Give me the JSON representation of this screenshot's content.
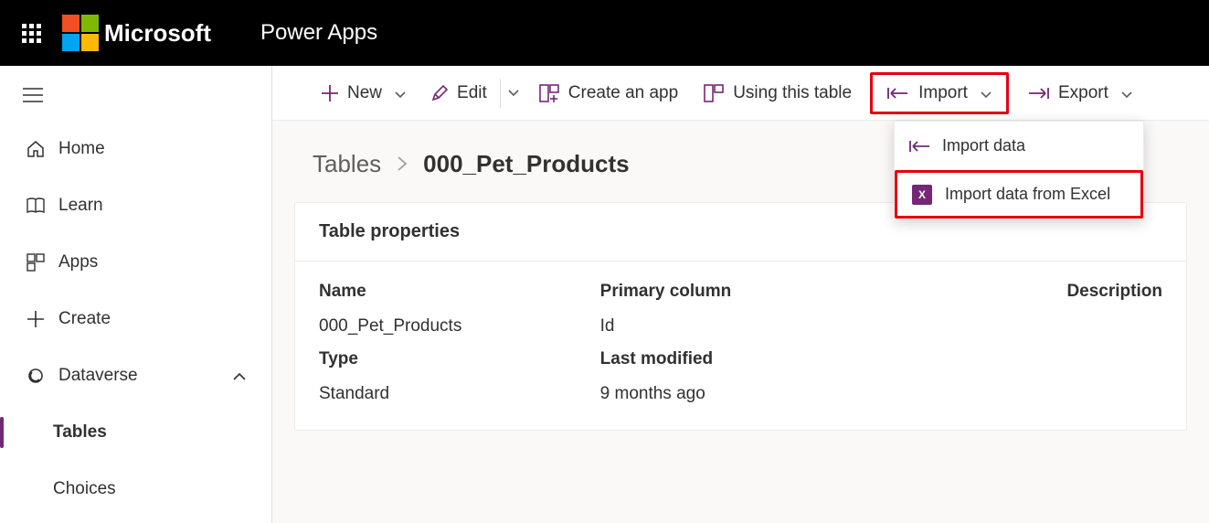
{
  "header": {
    "brand": "Microsoft",
    "app": "Power Apps"
  },
  "sidebar": {
    "items": [
      {
        "label": "Home"
      },
      {
        "label": "Learn"
      },
      {
        "label": "Apps"
      },
      {
        "label": "Create"
      },
      {
        "label": "Dataverse"
      },
      {
        "label": "Tables"
      },
      {
        "label": "Choices"
      }
    ]
  },
  "commands": {
    "new": "New",
    "edit": "Edit",
    "create_app": "Create an app",
    "using_table": "Using this table",
    "import": "Import",
    "export": "Export"
  },
  "breadcrumb": {
    "parent": "Tables",
    "current": "000_Pet_Products"
  },
  "card": {
    "title": "Table properties",
    "labels": {
      "name": "Name",
      "primary": "Primary column",
      "description": "Description",
      "type": "Type",
      "modified": "Last modified"
    },
    "values": {
      "name": "000_Pet_Products",
      "primary": "Id",
      "type": "Standard",
      "modified": "9 months ago"
    }
  },
  "import_menu": {
    "item1": "Import data",
    "item2": "Import data from Excel"
  }
}
